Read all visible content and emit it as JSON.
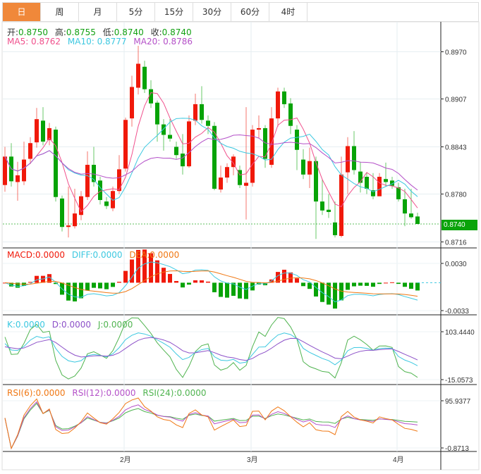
{
  "tabs": [
    {
      "label": "日"
    },
    {
      "label": "周"
    },
    {
      "label": "月"
    },
    {
      "label": "5分"
    },
    {
      "label": "15分"
    },
    {
      "label": "30分"
    },
    {
      "label": "60分"
    },
    {
      "label": "4时"
    }
  ],
  "ohlc_legend": {
    "open_label": "开:",
    "open": "0.8750",
    "high_label": "高:",
    "high": "0.8755",
    "low_label": "低:",
    "low": "0.8740",
    "close_label": "收:",
    "close": "0.8740"
  },
  "ma_legend": {
    "ma5": "MA5: 0.8762",
    "ma10": "MA10: 0.8777",
    "ma20": "MA20: 0.8786"
  },
  "macd_legend": {
    "macd": "MACD:0.0000",
    "diff": "DIFF:0.0000",
    "dea": "DEA:0.0000"
  },
  "kdj_legend": {
    "k": "K:0.0000",
    "d": "D:0.0000",
    "j": "J:0.0000"
  },
  "rsi_legend": {
    "rsi6": "RSI(6):0.0000",
    "rsi12": "RSI(12):0.0000",
    "rsi24": "RSI(24):0.0000"
  },
  "price_axis": {
    "ticks": [
      "0.8970",
      "0.8907",
      "0.8843",
      "0.8780",
      "0.8716"
    ],
    "tick_values": [
      0.897,
      0.8907,
      0.8843,
      0.878,
      0.8716
    ],
    "range": [
      0.8708,
      0.901
    ],
    "last_price": "0.8740",
    "last_value": 0.874
  },
  "macd_axis": {
    "ticks": [
      "0.0030",
      "-0.0033"
    ],
    "range": [
      -0.0036,
      0.0039
    ]
  },
  "kdj_axis": {
    "ticks": [
      "103.4440",
      "-15.0573"
    ],
    "range": [
      -20,
      115
    ]
  },
  "rsi_axis": {
    "ticks": [
      "95.9377",
      "-0.8713"
    ],
    "range": [
      -5,
      105
    ]
  },
  "x_axis": {
    "labels": [
      {
        "text": "2月",
        "index": 19
      },
      {
        "text": "3月",
        "index": 39
      },
      {
        "text": "4月",
        "index": 62
      }
    ]
  },
  "colors": {
    "up": "#f0190a",
    "down": "#07a307",
    "ma5": "#f0508c",
    "ma10": "#3cc8e0",
    "ma20": "#b450c8",
    "accent": "#f0883a",
    "macd_dea": "#f07814"
  },
  "candles": [
    [
      0.8792,
      0.883,
      0.8843,
      0.8783
    ],
    [
      0.883,
      0.8797,
      0.8848,
      0.879
    ],
    [
      0.8796,
      0.8805,
      0.8823,
      0.8771
    ],
    [
      0.8797,
      0.8826,
      0.885,
      0.8792
    ],
    [
      0.8827,
      0.8848,
      0.8856,
      0.882
    ],
    [
      0.8849,
      0.888,
      0.8895,
      0.8842
    ],
    [
      0.8878,
      0.885,
      0.8896,
      0.8845
    ],
    [
      0.8852,
      0.8868,
      0.8875,
      0.8845
    ],
    [
      0.8866,
      0.8776,
      0.887,
      0.877
    ],
    [
      0.8774,
      0.8736,
      0.8778,
      0.873
    ],
    [
      0.8736,
      0.8738,
      0.879,
      0.8722
    ],
    [
      0.8737,
      0.8754,
      0.8787,
      0.8734
    ],
    [
      0.8752,
      0.8777,
      0.8784,
      0.8745
    ],
    [
      0.8776,
      0.8819,
      0.8837,
      0.8772
    ],
    [
      0.8819,
      0.8796,
      0.8843,
      0.879
    ],
    [
      0.8798,
      0.8772,
      0.8803,
      0.8766
    ],
    [
      0.877,
      0.8764,
      0.8776,
      0.876
    ],
    [
      0.8761,
      0.8784,
      0.879,
      0.8757
    ],
    [
      0.8784,
      0.8813,
      0.8832,
      0.878
    ],
    [
      0.8814,
      0.8879,
      0.8882,
      0.881
    ],
    [
      0.8881,
      0.8923,
      0.8938,
      0.887
    ],
    [
      0.8922,
      0.8954,
      0.8978,
      0.8913
    ],
    [
      0.895,
      0.892,
      0.8958,
      0.8915
    ],
    [
      0.892,
      0.8901,
      0.8932,
      0.8895
    ],
    [
      0.8902,
      0.8873,
      0.8905,
      0.885
    ],
    [
      0.8873,
      0.8859,
      0.888,
      0.8838
    ],
    [
      0.8859,
      0.8854,
      0.888,
      0.885
    ],
    [
      0.8843,
      0.8832,
      0.885,
      0.8827
    ],
    [
      0.8834,
      0.8817,
      0.886,
      0.8806
    ],
    [
      0.8817,
      0.8877,
      0.8885,
      0.8815
    ],
    [
      0.8878,
      0.89,
      0.8914,
      0.8872
    ],
    [
      0.89,
      0.8879,
      0.8924,
      0.8874
    ],
    [
      0.8878,
      0.8871,
      0.8885,
      0.886
    ],
    [
      0.8871,
      0.8787,
      0.8876,
      0.8785
    ],
    [
      0.8786,
      0.8802,
      0.8818,
      0.8782
    ],
    [
      0.8802,
      0.8816,
      0.8821,
      0.8795
    ],
    [
      0.8816,
      0.883,
      0.8833,
      0.8805
    ],
    [
      0.8812,
      0.8792,
      0.8818,
      0.8788
    ],
    [
      0.8791,
      0.8795,
      0.8896,
      0.8746
    ],
    [
      0.8795,
      0.8866,
      0.8872,
      0.879
    ],
    [
      0.8866,
      0.8868,
      0.8885,
      0.8855
    ],
    [
      0.8868,
      0.8827,
      0.8872,
      0.8815
    ],
    [
      0.8819,
      0.8881,
      0.8896,
      0.8815
    ],
    [
      0.8881,
      0.8917,
      0.8922,
      0.887
    ],
    [
      0.8917,
      0.89,
      0.8922,
      0.8895
    ],
    [
      0.8901,
      0.8871,
      0.8908,
      0.886
    ],
    [
      0.8866,
      0.8839,
      0.8872,
      0.8812
    ],
    [
      0.8826,
      0.8806,
      0.884,
      0.88
    ],
    [
      0.8806,
      0.8824,
      0.8842,
      0.8788
    ],
    [
      0.8824,
      0.877,
      0.883,
      0.872
    ],
    [
      0.877,
      0.8758,
      0.88,
      0.8752
    ],
    [
      0.8759,
      0.8756,
      0.878,
      0.8748
    ],
    [
      0.8742,
      0.8725,
      0.877,
      0.8722
    ],
    [
      0.8724,
      0.8806,
      0.883,
      0.8722
    ],
    [
      0.8809,
      0.8844,
      0.8856,
      0.878
    ],
    [
      0.8844,
      0.8812,
      0.8864,
      0.8806
    ],
    [
      0.881,
      0.8795,
      0.8823,
      0.8782
    ],
    [
      0.8803,
      0.8787,
      0.8808,
      0.878
    ],
    [
      0.8785,
      0.8777,
      0.8808,
      0.8773
    ],
    [
      0.8777,
      0.8803,
      0.8808,
      0.8777
    ],
    [
      0.88,
      0.8796,
      0.8822,
      0.879
    ],
    [
      0.8798,
      0.8791,
      0.8803,
      0.8787
    ],
    [
      0.8789,
      0.8773,
      0.8795,
      0.877
    ],
    [
      0.8773,
      0.8754,
      0.8787,
      0.8737
    ],
    [
      0.8754,
      0.8749,
      0.8787,
      0.8747
    ],
    [
      0.875,
      0.874,
      0.8755,
      0.874
    ]
  ]
}
